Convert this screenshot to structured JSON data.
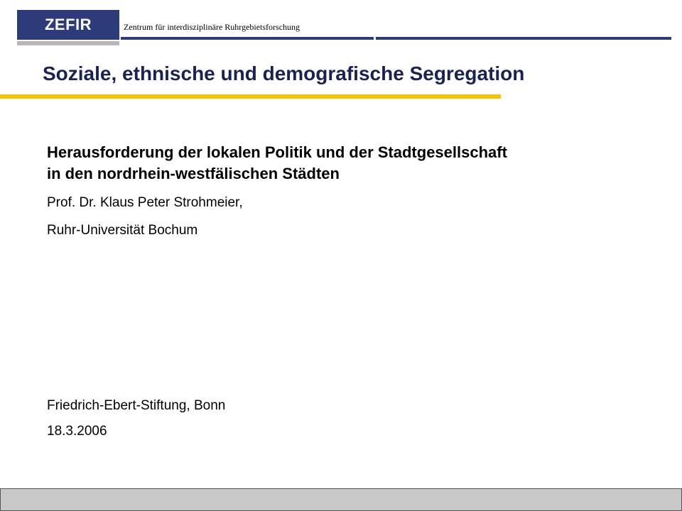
{
  "header": {
    "logo_text": "ZEFIR",
    "organization": "Zentrum für interdisziplinäre Ruhrgebietsforschung"
  },
  "slide": {
    "title": "Soziale, ethnische und demografische Segregation",
    "subtitle_line1": "Herausforderung der lokalen Politik und der Stadtgesellschaft",
    "subtitle_line2": "in den nordrhein-westfälischen Städten",
    "author": "Prof. Dr. Klaus Peter Strohmeier,",
    "university": "Ruhr-Universität Bochum",
    "event": "Friedrich-Ebert-Stiftung, Bonn",
    "date": "18.3.2006"
  },
  "colors": {
    "brand_blue": "#2e3b7a",
    "accent_yellow": "#f5c400",
    "footer_gray": "#c8c8c8"
  }
}
